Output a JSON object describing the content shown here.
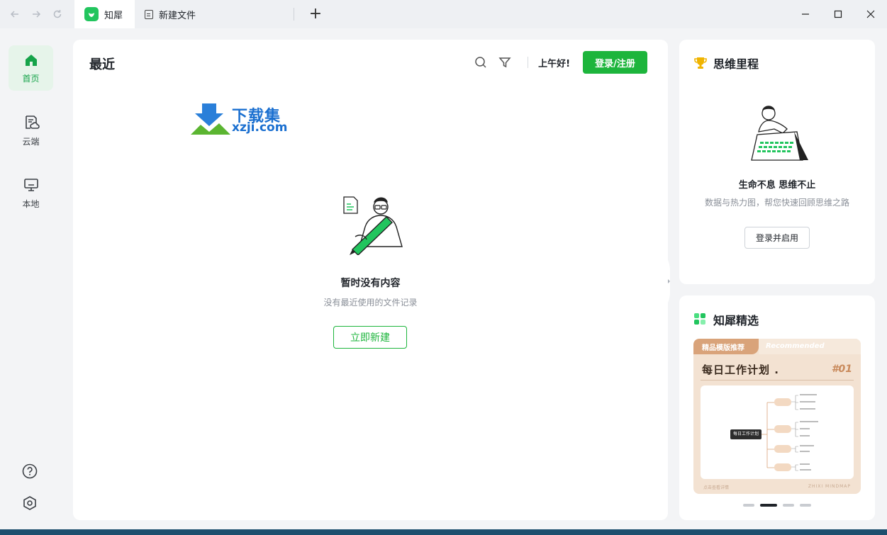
{
  "titlebar": {
    "tabs": [
      {
        "label": "知犀"
      },
      {
        "label": "新建文件"
      }
    ]
  },
  "rail": {
    "items": [
      {
        "label": "首页"
      },
      {
        "label": "云端"
      },
      {
        "label": "本地"
      }
    ]
  },
  "main": {
    "title": "最近",
    "greeting": "上午好!",
    "login_label": "登录/注册",
    "watermark_name": "下载集",
    "watermark_url": "xzji.com",
    "empty_title": "暂时没有内容",
    "empty_subtitle": "没有最近使用的文件记录",
    "new_label": "立即新建"
  },
  "milestones": {
    "title": "思维里程",
    "heading": "生命不息 思维不止",
    "subtitle": "数据与热力图，帮您快速回顾思维之路",
    "button_label": "登录并启用"
  },
  "featured": {
    "title": "知犀精选",
    "banner": {
      "tag": "精品模版推荐",
      "tag_en": "Recommended",
      "title": "每日工作计划 .",
      "number": "#01",
      "center_node": "每日工作计划",
      "footer_left": "点击查看详情",
      "footer_right": "ZHIXI MINDMAP"
    },
    "carousel_active_index": 1,
    "carousel_count": 4
  },
  "colors": {
    "accent": "#1db53c",
    "active_rail_bg": "#e6f4ea"
  },
  "icons": [
    "back-arrow-icon",
    "forward-arrow-icon",
    "refresh-icon",
    "add-tab-icon",
    "minimize-icon",
    "maximize-icon",
    "close-icon",
    "home-icon",
    "cloud-doc-icon",
    "monitor-icon",
    "help-icon",
    "settings-icon",
    "search-icon",
    "filter-icon",
    "trophy-icon",
    "grid-icon"
  ]
}
